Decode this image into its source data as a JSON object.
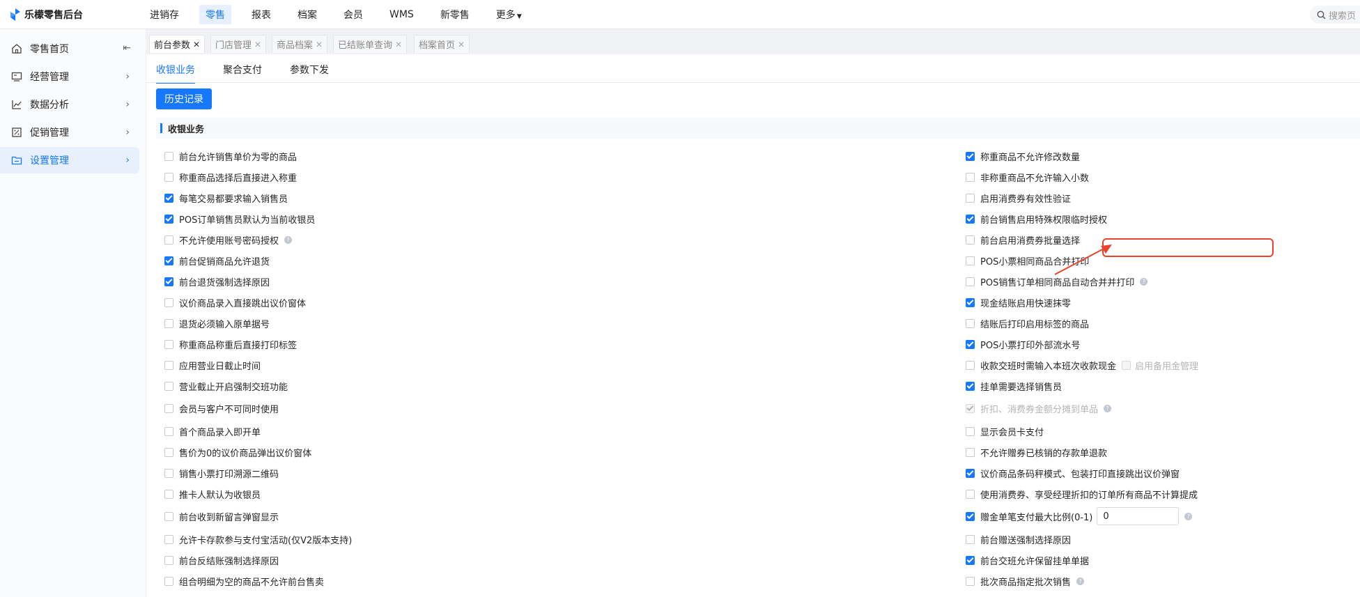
{
  "app": {
    "title": "乐檬零售后台"
  },
  "topnav": {
    "items": [
      {
        "label": "进销存"
      },
      {
        "label": "零售"
      },
      {
        "label": "报表"
      },
      {
        "label": "档案"
      },
      {
        "label": "会员"
      },
      {
        "label": "WMS"
      },
      {
        "label": "新零售"
      },
      {
        "label": "更多"
      }
    ],
    "search_placeholder": "搜索页"
  },
  "sidebar": {
    "items": [
      {
        "label": "零售首页",
        "icon": "home-icon"
      },
      {
        "label": "经营管理",
        "icon": "monitor-icon"
      },
      {
        "label": "数据分析",
        "icon": "line-chart-icon"
      },
      {
        "label": "促销管理",
        "icon": "discount-icon"
      },
      {
        "label": "设置管理",
        "icon": "folder-icon"
      }
    ]
  },
  "tabs": [
    {
      "label": "前台参数"
    },
    {
      "label": "门店管理"
    },
    {
      "label": "商品档案"
    },
    {
      "label": "已结账单查询"
    },
    {
      "label": "档案首页"
    }
  ],
  "subtabs": [
    {
      "label": "收银业务"
    },
    {
      "label": "聚合支付"
    },
    {
      "label": "参数下发"
    }
  ],
  "history_button": "历史记录",
  "section_title": "收银业务",
  "options_left": [
    {
      "label": "前台允许销售单价为零的商品",
      "checked": false
    },
    {
      "label": "称重商品选择后直接进入称重",
      "checked": false
    },
    {
      "label": "每笔交易都要求输入销售员",
      "checked": true
    },
    {
      "label": "POS订单销售员默认为当前收银员",
      "checked": true
    },
    {
      "label": "不允许使用账号密码授权",
      "checked": false
    },
    {
      "label": "前台促销商品允许退货",
      "checked": true
    },
    {
      "label": "前台退货强制选择原因",
      "checked": true
    },
    {
      "label": "议价商品录入直接跳出议价窗体",
      "checked": false
    },
    {
      "label": "退货必须输入原单据号",
      "checked": false
    },
    {
      "label": "称重商品称重后直接打印标签",
      "checked": false
    },
    {
      "label": "应用营业日截止时间",
      "checked": false
    },
    {
      "label": "营业截止开启强制交班功能",
      "checked": false
    },
    {
      "label": "会员与客户不可同时使用",
      "checked": false
    },
    {
      "label": "首个商品录入即开单",
      "checked": false
    },
    {
      "label": "售价为0的议价商品弹出议价窗体",
      "checked": false
    },
    {
      "label": "销售小票打印溯源二维码",
      "checked": false
    },
    {
      "label": "推卡人默认为收银员",
      "checked": false
    },
    {
      "label": "前台收到新留言弹窗显示",
      "checked": false
    },
    {
      "label": "允许卡存款参与支付宝活动(仅V2版本支持)",
      "checked": false
    },
    {
      "label": "前台反结账强制选择原因",
      "checked": false
    },
    {
      "label": "组合明细为空的商品不允许前台售卖",
      "checked": false
    }
  ],
  "options_right": [
    {
      "label": "称重商品不允许修改数量",
      "checked": true
    },
    {
      "label": "非称重商品不允许输入小数",
      "checked": false
    },
    {
      "label": "启用消费券有效性验证",
      "checked": false
    },
    {
      "label": "前台销售启用特殊权限临时授权",
      "checked": true
    },
    {
      "label": "前台启用消费券批量选择",
      "checked": false
    },
    {
      "label": "POS小票相同商品合并打印",
      "checked": false
    },
    {
      "label": "POS销售订单相同商品自动合并并打印",
      "checked": false
    },
    {
      "label": "现金结账启用快速抹零",
      "checked": true
    },
    {
      "label": "结账后打印启用标签的商品",
      "checked": false
    },
    {
      "label": "POS小票打印外部流水号",
      "checked": true
    },
    {
      "label": "收款交班时需输入本班次收款现金",
      "checked": false,
      "sub_label": "启用备用金管理"
    },
    {
      "label": "挂单需要选择销售员",
      "checked": true
    },
    {
      "label": "折扣、消费券金额分摊到单品",
      "checked": true
    },
    {
      "label": "显示会员卡支付",
      "checked": false
    },
    {
      "label": "不允许赠券已核销的存款单退款",
      "checked": false
    },
    {
      "label": "议价商品条码秤模式、包装打印直接跳出议价弹窗",
      "checked": true
    },
    {
      "label": "使用消费券、享受经理折扣的订单所有商品不计算提成",
      "checked": false
    },
    {
      "label": "赠金单笔支付最大比例(0-1)",
      "checked": true,
      "input_value": "0"
    },
    {
      "label": "前台赠送强制选择原因",
      "checked": false
    },
    {
      "label": "前台交班允许保留挂单单据",
      "checked": true
    },
    {
      "label": "批次商品指定批次销售",
      "checked": false
    }
  ]
}
